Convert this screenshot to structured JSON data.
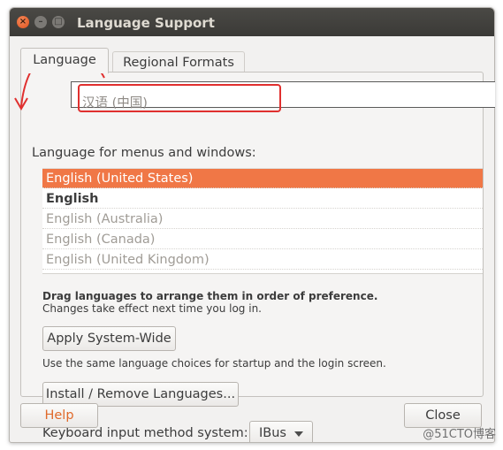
{
  "window": {
    "title": "Language Support",
    "buttons": {
      "close": "×",
      "minimize": "–",
      "maximize": "□"
    }
  },
  "tabs": [
    {
      "label": "Language",
      "active": true
    },
    {
      "label": "Regional Formats",
      "active": false
    }
  ],
  "language_heading": "Language for menus and windows:",
  "languages": [
    {
      "label": "English (United States)",
      "state": "selected"
    },
    {
      "label": "English",
      "state": "bold"
    },
    {
      "label": "English (Australia)",
      "state": "dim"
    },
    {
      "label": "English (Canada)",
      "state": "dim"
    },
    {
      "label": "English (United Kingdom)",
      "state": "dim"
    }
  ],
  "drag_hint": "Drag languages to arrange them in order of preference.",
  "changes_note": "Changes take effect next time you log in.",
  "apply_button": "Apply System-Wide",
  "apply_description": "Use the same language choices for startup and the login screen.",
  "install_button": "Install / Remove Languages...",
  "keyboard_label": "Keyboard input method system:",
  "keyboard_value": "IBus",
  "help_button": "Help",
  "close_button": "Close",
  "annotation": {
    "text": "汉语 (中国)",
    "box_color": "#e0302f"
  },
  "watermark": "@51CTO博客",
  "colors": {
    "accent": "#f07746",
    "titlebar": "#3b3a37",
    "help_text": "#e06a2b"
  }
}
